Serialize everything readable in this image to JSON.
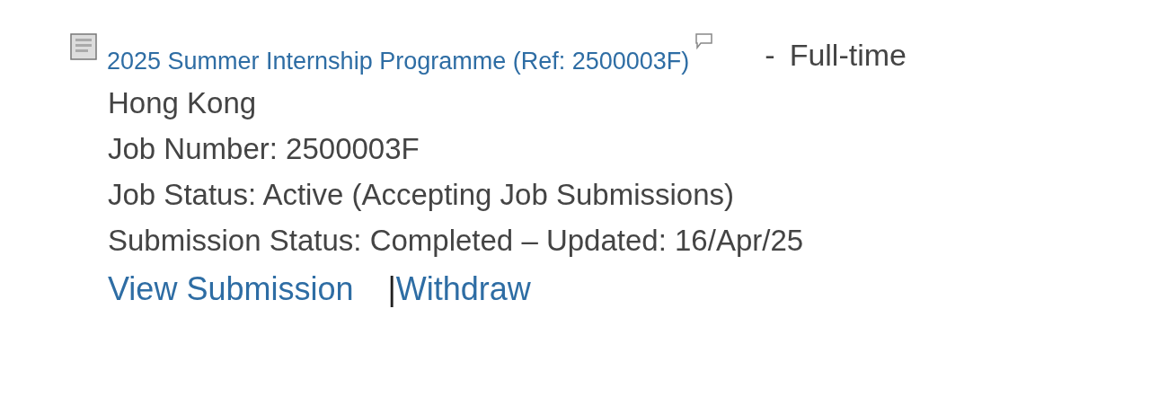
{
  "job": {
    "title": "2025 Summer Internship Programme (Ref: 2500003F)",
    "separator": "-",
    "type": "Full-time",
    "details": [
      "Hong Kong",
      "Job Number: 2500003F",
      "Job Status: Active (Accepting Job Submissions)",
      "Submission Status: Completed – Updated: 16/Apr/25"
    ],
    "links": [
      {
        "label": "View Submission"
      },
      {
        "label": "Withdraw"
      }
    ],
    "link_separator": "|"
  }
}
